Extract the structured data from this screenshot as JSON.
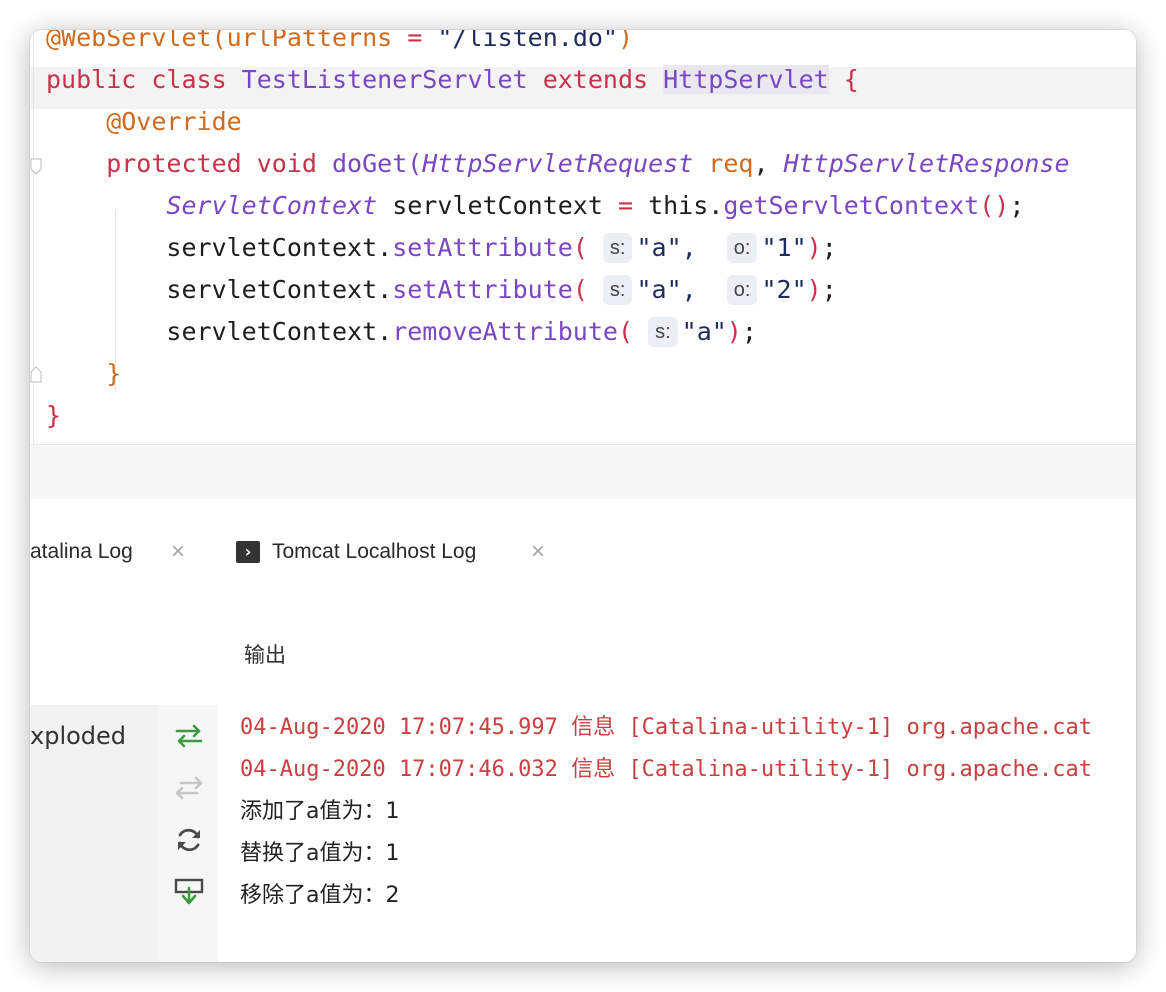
{
  "editor": {
    "lines": [
      {
        "parts": [
          {
            "t": "@WebServlet(",
            "c": "ann"
          },
          {
            "t": "urlPatterns",
            "c": "ann"
          },
          {
            "t": " = ",
            "c": "op"
          },
          {
            "t": "\"/listen.do\"",
            "c": "str"
          },
          {
            "t": ")",
            "c": "ann"
          }
        ]
      },
      {
        "parts": [
          {
            "t": "public class ",
            "c": "kw"
          },
          {
            "t": "TestListenerServlet",
            "c": "cls"
          },
          {
            "t": " extends ",
            "c": "kw"
          },
          {
            "t": "HttpServlet",
            "c": "cls hlword"
          },
          {
            "t": " {",
            "c": "brace2"
          }
        ]
      },
      {
        "parts": [
          {
            "t": "    @Override",
            "c": "ann"
          }
        ]
      },
      {
        "parts": [
          {
            "t": "    protected void ",
            "c": "kw"
          },
          {
            "t": "doGet(",
            "c": "mth"
          },
          {
            "t": "HttpServletRequest",
            "c": "cls it"
          },
          {
            "t": " ",
            "c": ""
          },
          {
            "t": "req",
            "c": "param"
          },
          {
            "t": ", ",
            "c": ""
          },
          {
            "t": "HttpServletResponse",
            "c": "cls it"
          }
        ]
      },
      {
        "parts": [
          {
            "t": "        ",
            "c": ""
          },
          {
            "t": "ServletContext",
            "c": "cls it"
          },
          {
            "t": " servletContext ",
            "c": ""
          },
          {
            "t": "=",
            "c": "op"
          },
          {
            "t": " this.",
            "c": ""
          },
          {
            "t": "getServletContext",
            "c": "mth"
          },
          {
            "t": "()",
            "c": "op"
          },
          {
            "t": ";",
            "c": ""
          }
        ]
      },
      {
        "parts": [
          {
            "t": "        servletContext.",
            "c": ""
          },
          {
            "t": "setAttribute",
            "c": "mth"
          },
          {
            "t": "( ",
            "c": "op"
          },
          {
            "hint": "s:"
          },
          {
            "t": "\"a\",  ",
            "c": "str"
          },
          {
            "hint": "o:"
          },
          {
            "t": "\"1\"",
            "c": "str"
          },
          {
            "t": ")",
            "c": "op"
          },
          {
            "t": ";",
            "c": ""
          }
        ]
      },
      {
        "parts": [
          {
            "t": "        servletContext.",
            "c": ""
          },
          {
            "t": "setAttribute",
            "c": "mth"
          },
          {
            "t": "( ",
            "c": "op"
          },
          {
            "hint": "s:"
          },
          {
            "t": "\"a\",  ",
            "c": "str"
          },
          {
            "hint": "o:"
          },
          {
            "t": "\"2\"",
            "c": "str"
          },
          {
            "t": ")",
            "c": "op"
          },
          {
            "t": ";",
            "c": ""
          }
        ]
      },
      {
        "parts": [
          {
            "t": "        servletContext.",
            "c": ""
          },
          {
            "t": "removeAttribute",
            "c": "mth"
          },
          {
            "t": "( ",
            "c": "op"
          },
          {
            "hint": "s:"
          },
          {
            "t": "\"a\"",
            "c": "str"
          },
          {
            "t": ")",
            "c": "op"
          },
          {
            "t": ";",
            "c": ""
          }
        ]
      },
      {
        "parts": [
          {
            "t": "    }",
            "c": "brace"
          }
        ]
      },
      {
        "parts": [
          {
            "t": "}",
            "c": "brace2"
          }
        ]
      }
    ]
  },
  "tabs": {
    "catalina_label": "atalina Log",
    "tomcat_label": "Tomcat Localhost Log",
    "close_glyph": "×",
    "terminal_glyph": "›"
  },
  "output": {
    "label": "输出",
    "deployment_label": "xploded"
  },
  "console": {
    "lines": [
      {
        "text": "04-Aug-2020 17:07:45.997 信息 [Catalina-utility-1] org.apache.cat",
        "style": "red"
      },
      {
        "text": "04-Aug-2020 17:07:46.032 信息 [Catalina-utility-1] org.apache.cat",
        "style": "red"
      },
      {
        "text": "添加了a值为：1",
        "style": "plain"
      },
      {
        "text": "替换了a值为：1",
        "style": "plain"
      },
      {
        "text": "移除了a值为：2",
        "style": "plain"
      }
    ]
  },
  "toolbar": {
    "icons": [
      "redeploy-icon",
      "update-disabled-icon",
      "reload-icon",
      "scroll-to-end-icon"
    ]
  }
}
